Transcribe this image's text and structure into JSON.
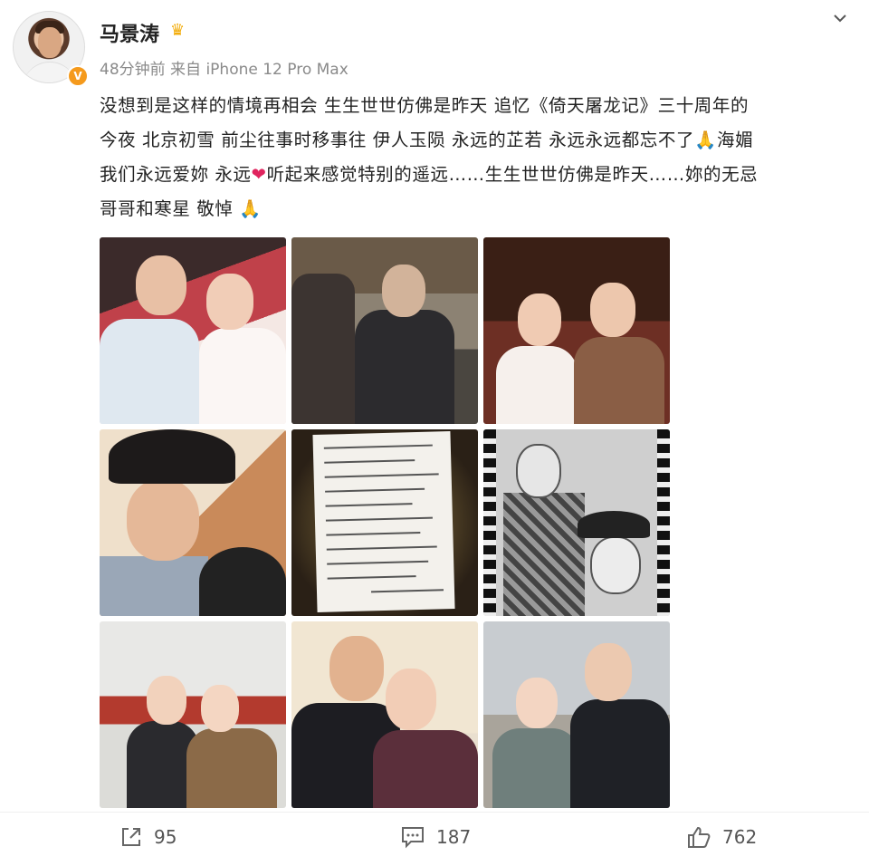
{
  "post": {
    "username": "马景涛",
    "time_source": "48分钟前  来自 iPhone 12 Pro Max",
    "text_line1": "没想到是这样的情境再相会 生生世世仿佛是昨天 追忆《倚天屠龙记》三十周年的",
    "text_line2a": "今夜 北京初雪 前尘往事时移事往 伊人玉陨 永远的芷若 永远永远都忘不了",
    "text_line2b": "海媚",
    "text_line3a": "我们永远爱妳 永远",
    "text_line3b": "听起来感觉特别的遥远……生生世世仿佛是昨天……妳的无忌",
    "text_line4": "哥哥和寒星 敬悼",
    "verified_badge": "V",
    "emoji_pray": "🙏",
    "emoji_heart": "❤"
  },
  "icons": {
    "avatar": "avatar",
    "vip": "crown-icon",
    "menu": "chevron-down-icon",
    "share": "share-icon",
    "comment": "comment-icon",
    "like": "thumbs-up-icon"
  },
  "photos": [
    {
      "name": "photo-1"
    },
    {
      "name": "photo-2"
    },
    {
      "name": "photo-3"
    },
    {
      "name": "photo-4"
    },
    {
      "name": "photo-5"
    },
    {
      "name": "photo-6"
    },
    {
      "name": "photo-7"
    },
    {
      "name": "photo-8"
    },
    {
      "name": "photo-9"
    }
  ],
  "actions": {
    "share_count": "95",
    "comment_count": "187",
    "like_count": "762"
  },
  "colors": {
    "vip_badge": "#f59a1c",
    "crown": "#f2a900",
    "heart": "#e0245e",
    "meta_text": "#8a8a8a"
  }
}
